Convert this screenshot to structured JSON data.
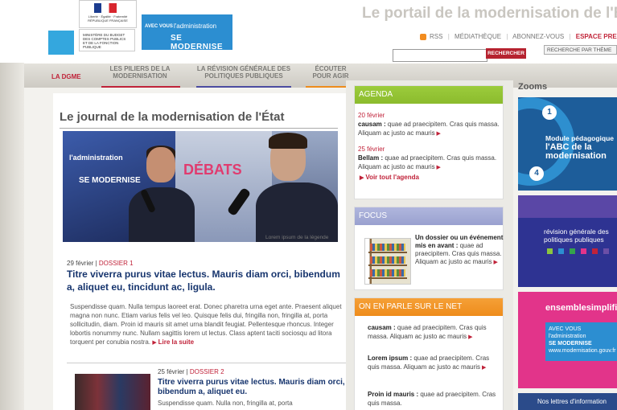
{
  "header": {
    "portal_title": "Le portail de la modernisation de l'État",
    "rf_logo_text": "Liberté · Égalité · Fraternité RÉPUBLIQUE FRANÇAISE",
    "ministere_text": "MINISTÈRE DU BUDGET DES COMPTES PUBLICS ET DE LA FONCTION PUBLIQUE",
    "banner_avec": "AVEC VOUS",
    "banner_admin": "l'administration",
    "banner_se": "SE MODERNISE",
    "links": {
      "rss": "RSS",
      "mediatheque": "MÉDIATHÈQUE",
      "abonnez": "ABONNEZ-VOUS",
      "espace": "ESPACE PRESSE"
    },
    "search_placeholder": "",
    "search_button": "RECHERCHER",
    "theme_button": "RECHERCHE PAR THÈME"
  },
  "nav": {
    "items": [
      {
        "label": "LA DGME"
      },
      {
        "label": "LES PILIERS DE LA MODERNISATION"
      },
      {
        "label": "LA RÉVISION GÉNÉRALE DES POLITIQUES PUBLIQUES"
      },
      {
        "label": "ÉCOUTER POUR AGIR"
      }
    ]
  },
  "main": {
    "title": "Le journal de la modernisation de l'État",
    "video": {
      "banner1": "l'administration",
      "banner2": "SE MODERNISE",
      "debat": "DÉBATS"
    },
    "caption": "Lorem ipsum de la légende",
    "article1": {
      "date": "29 février",
      "sep": " | ",
      "dossier": "DOSSIER 1",
      "title": "Titre viverra purus vitae lectus. Mauris diam orci, bibendum a, aliquet eu, tincidunt ac, ligula.",
      "body": "Suspendisse quam. Nulla tempus laoreet erat. Donec pharetra urna eget ante. Praesent aliquet magna non nunc. Etiam varius felis vel leo. Quisque felis dui, fringilla non, fringilla at, porta sollicitudin, diam. Proin id mauris sit amet urna blandit feugiat. Pellentesque rhoncus. Integer lobortis nonummy nunc. Nullam sagittis lorem ut lectus. Class aptent taciti sociosqu ad litora torquent per conubia nostra.",
      "more": "Lire la suite"
    },
    "article2": {
      "date": "25 février",
      "sep": " | ",
      "dossier": "DOSSIER 2",
      "title": "Titre viverra purus vitae lectus. Mauris diam orci, bibendum a, aliquet eu.",
      "body": "Suspendisse quam. Nulla non, fringilla at, porta"
    }
  },
  "agenda": {
    "title": "AGENDA",
    "items": [
      {
        "date": "20 février",
        "name": "causam :",
        "text": " quae ad praecipitem. Cras quis massa. Aliquam ac justo ac mauris"
      },
      {
        "date": "25 février",
        "name": "Bellam :",
        "text": " quae ad praecipitem. Cras quis massa. Aliquam ac justo ac mauris"
      }
    ],
    "link": "Voir tout l'agenda"
  },
  "focus": {
    "title": "FOCUS",
    "headline": "Un dossier ou un événement mis en avant :",
    "text": " quae ad praecipitem. Cras quis massa. Aliquam ac justo ac mauris"
  },
  "net": {
    "title": "ON EN PARLE SUR LE NET",
    "items": [
      {
        "name": "causam :",
        "text": " quae ad praecipitem. Cras quis massa. Aliquam ac justo ac mauris"
      },
      {
        "name": "Lorem ipsum :",
        "text": " quae ad praecipitem. Cras quis massa. Aliquam ac justo ac mauris"
      },
      {
        "name": "Proin id mauris :",
        "text": " quae ad praecipitem. Cras quis massa."
      }
    ]
  },
  "zooms": {
    "title": "Zooms",
    "zoom1": {
      "line1": "Module pédagogique",
      "line2": "l'ABC de la",
      "line3": "modernisation"
    },
    "zoom2": {
      "text": "révision générale des politiques publiques"
    },
    "zoom3": {
      "title": "ensemblesimplifi",
      "inner1": "AVEC VOUS l'administration",
      "inner2": "SE MODERNISE",
      "inner3": "www.modernisation.gouv.fr"
    },
    "newsletter": "Nos lettres d'information"
  },
  "colors": {
    "accent": "#c02239",
    "link_blue": "#17356e",
    "agenda_green": "#9ccc3c",
    "focus_purple": "#b0b6dd",
    "net_orange": "#f5a037"
  }
}
